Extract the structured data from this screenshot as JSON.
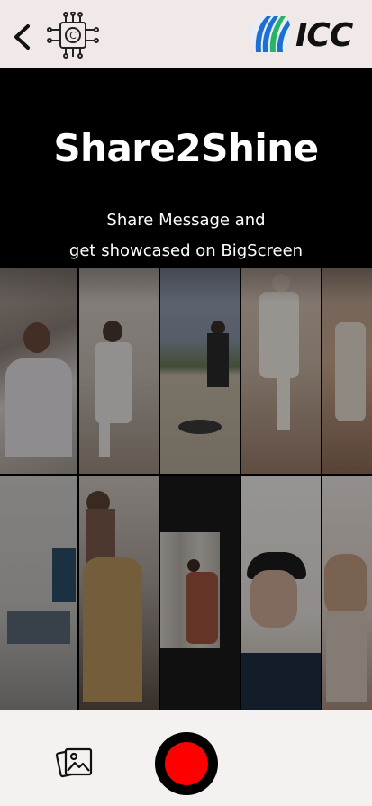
{
  "header": {
    "back_icon": "chevron-left-icon",
    "feature_icon": "circuit-copyright-icon",
    "logo_text": "ICC",
    "logo_colors": [
      "#1d6fd1",
      "#28b463",
      "#111111"
    ]
  },
  "hero": {
    "title": "Share2Shine",
    "subtitle_line1": "Share Message and",
    "subtitle_line2": "get showcased on BigScreen"
  },
  "bottom": {
    "gallery_icon": "image-gallery-icon",
    "record_icon": "record-button",
    "record_color": "#ff0000"
  }
}
